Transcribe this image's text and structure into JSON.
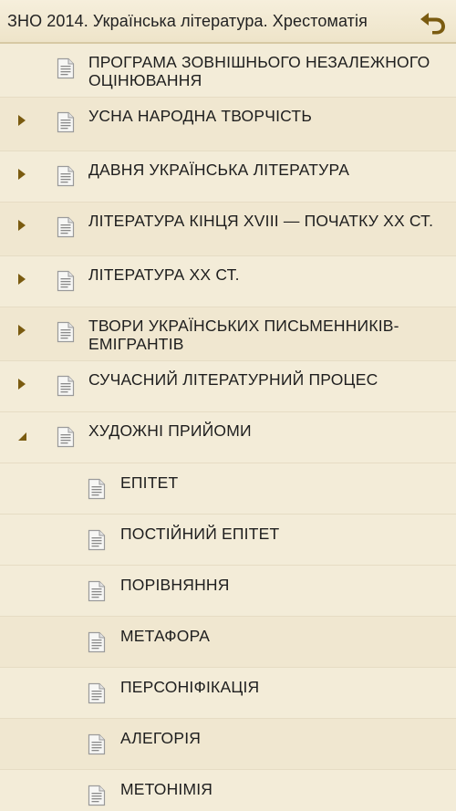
{
  "header": {
    "title": "ЗНО 2014. Українська література. Хрестоматія",
    "back_icon": "undo-arrow-icon"
  },
  "colors": {
    "background": "#f3ecd8",
    "arrow": "#7a5b10",
    "back_icon": "#7a5b10"
  },
  "items": [
    {
      "label": "ПРОГРАМА ЗОВНІШНЬОГО НЕЗАЛЕЖНОГО ОЦІНЮВАННЯ",
      "level": 1,
      "state": "none"
    },
    {
      "label": "УСНА НАРОДНА ТВОРЧІСТЬ",
      "level": 1,
      "state": "collapsed"
    },
    {
      "label": "ДАВНЯ УКРАЇНСЬКА ЛІТЕРАТУРА",
      "level": 1,
      "state": "collapsed"
    },
    {
      "label": "ЛІТЕРАТУРА КІНЦЯ XVIII — ПОЧАТКУ XX СТ.",
      "level": 1,
      "state": "collapsed"
    },
    {
      "label": "ЛІТЕРАТУРА XX СТ.",
      "level": 1,
      "state": "collapsed"
    },
    {
      "label": "ТВОРИ УКРАЇНСЬКИХ ПИСЬМЕННИКІВ-ЕМІГРАНТІВ",
      "level": 1,
      "state": "collapsed"
    },
    {
      "label": "СУЧАСНИЙ ЛІТЕРАТУРНИЙ ПРОЦЕС",
      "level": 1,
      "state": "collapsed"
    },
    {
      "label": "ХУДОЖНІ ПРИЙОМИ",
      "level": 1,
      "state": "expanded"
    },
    {
      "label": "ЕПІТЕТ",
      "level": 2,
      "state": "none"
    },
    {
      "label": "ПОСТІЙНИЙ ЕПІТЕТ",
      "level": 2,
      "state": "none"
    },
    {
      "label": "ПОРІВНЯННЯ",
      "level": 2,
      "state": "none"
    },
    {
      "label": "МЕТАФОРА",
      "level": 2,
      "state": "none"
    },
    {
      "label": "ПЕРСОНІФІКАЦІЯ",
      "level": 2,
      "state": "none"
    },
    {
      "label": "АЛЕГОРІЯ",
      "level": 2,
      "state": "none"
    },
    {
      "label": "МЕТОНІМІЯ",
      "level": 2,
      "state": "none"
    }
  ]
}
